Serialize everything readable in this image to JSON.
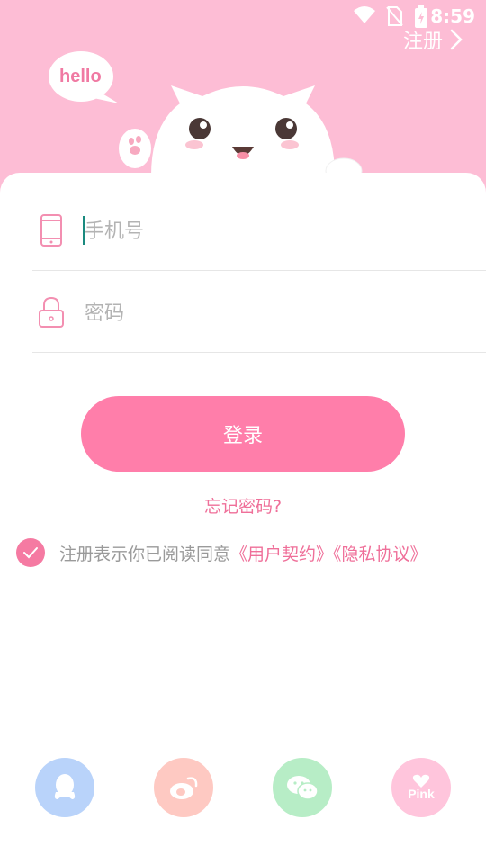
{
  "status_bar": {
    "time": "8:59",
    "icons": [
      "wifi-icon",
      "no-sim-icon",
      "battery-charging-icon"
    ]
  },
  "header": {
    "register_label": "注册",
    "bubble_text": "hello"
  },
  "form": {
    "phone_placeholder": "手机号",
    "phone_value": "",
    "password_placeholder": "密码",
    "password_value": ""
  },
  "actions": {
    "login_label": "登录",
    "forgot_label": "忘记密码?"
  },
  "agreement": {
    "checked": true,
    "prefix": "注册表示你已阅读同意",
    "user_agreement": "《用户契约》",
    "privacy_policy": "《隐私协议》"
  },
  "social_login": {
    "items": [
      "qq-icon",
      "weibo-icon",
      "wechat-icon",
      "pink-icon"
    ],
    "pink_label": "Pink"
  },
  "colors": {
    "header_bg": "#fdbdd5",
    "accent": "#ff7eaa",
    "link": "#ef6f99"
  }
}
